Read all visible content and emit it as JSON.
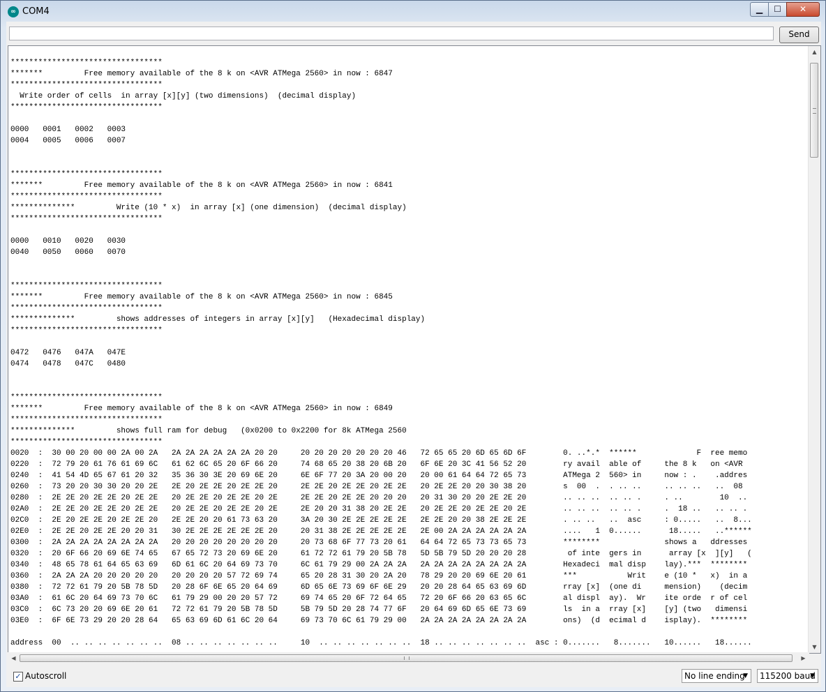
{
  "window": {
    "title": "COM4",
    "icon": "arduino-icon",
    "minimize_glyph": "▁",
    "maximize_glyph": "☐",
    "close_glyph": "✕"
  },
  "send": {
    "input_value": "",
    "button_label": "Send"
  },
  "output": {
    "lines": [
      "*********************************",
      "*******         Free memory available of the 8 k on <AVR ATMega 2560> in now : 6847",
      "*********************************",
      "  Write order of cells  in array [x][y] (two dimensions)  (decimal display)",
      "*********************************",
      "",
      "0000   0001   0002   0003",
      "0004   0005   0006   0007",
      "",
      "",
      "*********************************",
      "*******         Free memory available of the 8 k on <AVR ATMega 2560> in now : 6841",
      "*********************************",
      "**************         Write (10 * x)  in array [x] (one dimension)  (decimal display)",
      "*********************************",
      "",
      "0000   0010   0020   0030",
      "0040   0050   0060   0070",
      "",
      "",
      "*********************************",
      "*******         Free memory available of the 8 k on <AVR ATMega 2560> in now : 6845",
      "*********************************",
      "**************         shows addresses of integers in array [x][y]   (Hexadecimal display)",
      "*********************************",
      "",
      "0472   0476   047A   047E",
      "0474   0478   047C   0480",
      "",
      "",
      "*********************************",
      "*******         Free memory available of the 8 k on <AVR ATMega 2560> in now : 6849",
      "*********************************",
      "**************         shows full ram for debug   (0x0200 to 0x2200 for 8k ATMega 2560",
      "*********************************",
      "0020  :  30 00 20 00 00 2A 00 2A   2A 2A 2A 2A 2A 2A 20 20     20 20 20 20 20 20 20 46   72 65 65 20 6D 65 6D 6F        0. ..*.*  ******             F  ree memo",
      "0220  :  72 79 20 61 76 61 69 6C   61 62 6C 65 20 6F 66 20     74 68 65 20 38 20 6B 20   6F 6E 20 3C 41 56 52 20        ry avail  able of     the 8 k   on <AVR",
      "0240  :  41 54 4D 65 67 61 20 32   35 36 30 3E 20 69 6E 20     6E 6F 77 20 3A 20 00 20   20 00 61 64 64 72 65 73        ATMega 2  560> in     now : .    .addres",
      "0260  :  73 20 20 30 30 20 20 2E   2E 20 2E 2E 20 2E 2E 20     2E 2E 20 2E 2E 20 2E 2E   20 2E 2E 20 20 30 38 20        s  00  .  . .. ..     .. .. ..   ..  08",
      "0280  :  2E 2E 20 2E 2E 20 2E 2E   20 2E 2E 20 2E 2E 20 2E     2E 2E 20 2E 2E 20 20 20   20 31 30 20 20 2E 2E 20        .. .. ..  .. .. .     . ..        10  ..",
      "02A0  :  2E 2E 20 2E 2E 20 2E 2E   20 2E 2E 20 2E 2E 20 2E     2E 20 20 31 38 20 2E 2E   20 2E 2E 20 2E 2E 20 2E        .. .. ..  .. .. .     .  18 ..   .. .. .",
      "02C0  :  2E 20 2E 2E 20 2E 2E 20   2E 2E 20 20 61 73 63 20     3A 20 30 2E 2E 2E 2E 2E   2E 2E 20 20 38 2E 2E 2E        . .. ..   ..  asc     : 0.....   ..  8...",
      "02E0  :  2E 2E 20 2E 2E 20 20 31   30 2E 2E 2E 2E 2E 2E 20     20 31 38 2E 2E 2E 2E 2E   2E 00 2A 2A 2A 2A 2A 2A        ....   1  0......      18.....   ..******",
      "0300  :  2A 2A 2A 2A 2A 2A 2A 2A   20 20 20 20 20 20 20 20     20 73 68 6F 77 73 20 61   64 64 72 65 73 73 65 73        ********              shows a   ddresses",
      "0320  :  20 6F 66 20 69 6E 74 65   67 65 72 73 20 69 6E 20     61 72 72 61 79 20 5B 78   5D 5B 79 5D 20 20 20 28         of inte  gers in      array [x  ][y]   (",
      "0340  :  48 65 78 61 64 65 63 69   6D 61 6C 20 64 69 73 70     6C 61 79 29 00 2A 2A 2A   2A 2A 2A 2A 2A 2A 2A 2A        Hexadeci  mal disp    lay).***  ********",
      "0360  :  2A 2A 2A 20 20 20 20 20   20 20 20 20 57 72 69 74     65 20 28 31 30 20 2A 20   78 29 20 20 69 6E 20 61        ***           Writ    e (10 *   x)  in a",
      "0380  :  72 72 61 79 20 5B 78 5D   20 28 6F 6E 65 20 64 69     6D 65 6E 73 69 6F 6E 29   20 20 28 64 65 63 69 6D        rray [x]  (one di     mension)    (decim",
      "03A0  :  61 6C 20 64 69 73 70 6C   61 79 29 00 20 20 57 72     69 74 65 20 6F 72 64 65   72 20 6F 66 20 63 65 6C        al displ  ay).  Wr    ite orde  r of cel",
      "03C0  :  6C 73 20 20 69 6E 20 61   72 72 61 79 20 5B 78 5D     5B 79 5D 20 28 74 77 6F   20 64 69 6D 65 6E 73 69        ls  in a  rray [x]    [y] (two   dimensi",
      "03E0  :  6F 6E 73 29 20 20 28 64   65 63 69 6D 61 6C 20 64     69 73 70 6C 61 79 29 00   2A 2A 2A 2A 2A 2A 2A 2A        ons)  (d  ecimal d    isplay).  ********",
      "",
      "address  00  .. .. .. .. .. .. ..  08 .. .. .. .. .. .. ..     10  .. .. .. .. .. .. ..  18 .. .. .. .. .. .. ..  asc : 0.......   8.......   10......   18......"
    ]
  },
  "bottom": {
    "autoscroll_label": "Autoscroll",
    "autoscroll_checked_glyph": "✓",
    "line_ending": "No line ending",
    "baud": "115200 baud",
    "dropdown_arrow": "▼"
  }
}
